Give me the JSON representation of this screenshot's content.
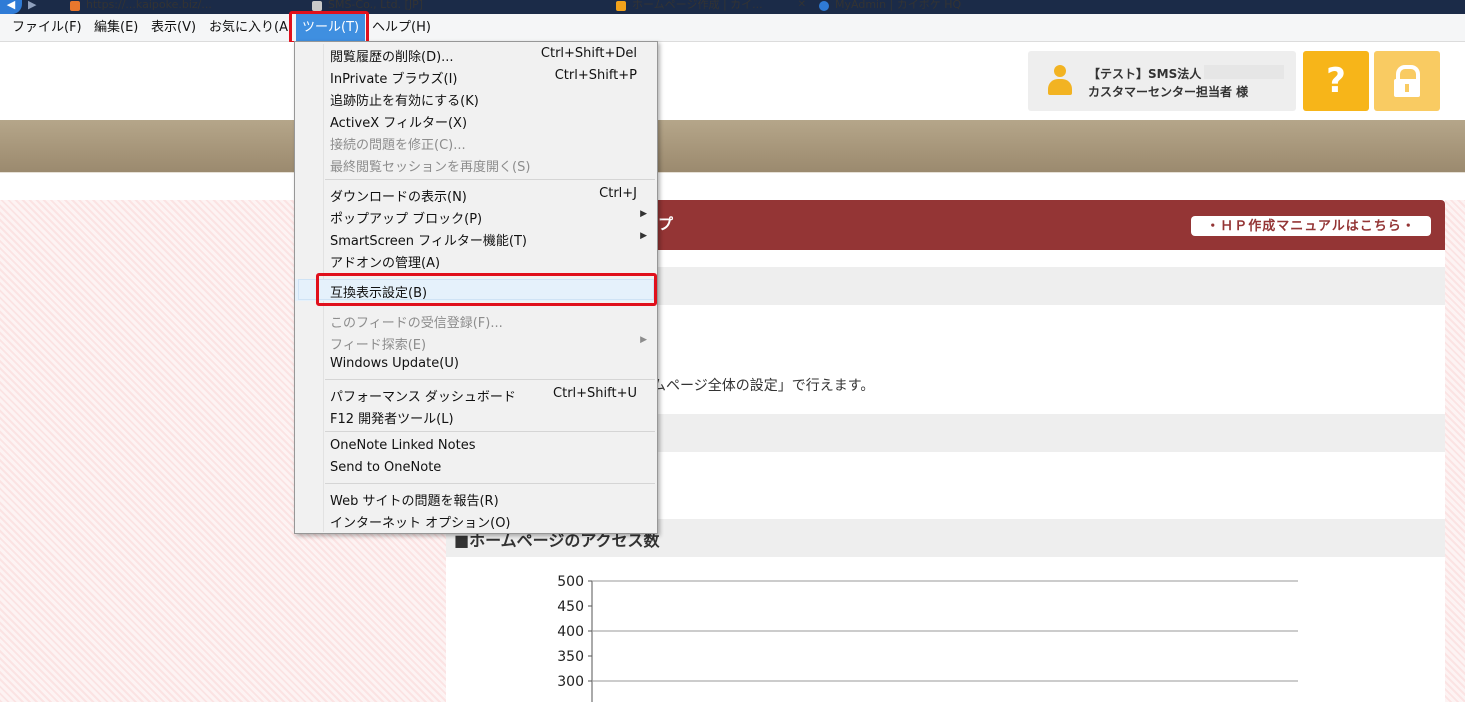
{
  "browser": {
    "tabs": [
      {
        "label": "https://...kaipoke.biz/...",
        "active": false,
        "color": "#4c9a2a"
      },
      {
        "label": "SMS-Co., Ltd. [JP]",
        "active": false,
        "color": "#e9e9e9"
      },
      {
        "label": "ホームページ作成 | カイ...",
        "active": true,
        "color": "#ffffff"
      },
      {
        "label": "MyAdmin | カイポケ HQ",
        "active": false,
        "color": "#e9e9e9"
      }
    ],
    "menu": [
      {
        "label": "ファイル(F)"
      },
      {
        "label": "編集(E)"
      },
      {
        "label": "表示(V)"
      },
      {
        "label": "お気に入り(A)"
      },
      {
        "label": "ツール(T)"
      },
      {
        "label": "ヘルプ(H)"
      }
    ]
  },
  "tools_menu": {
    "groups": [
      [
        {
          "label": "閲覧履歴の削除(D)...",
          "shortcut": "Ctrl+Shift+Del",
          "disabled": false
        },
        {
          "label": "InPrivate ブラウズ(I)",
          "shortcut": "Ctrl+Shift+P",
          "disabled": false
        },
        {
          "label": "追跡防止を有効にする(K)",
          "shortcut": "",
          "disabled": false
        },
        {
          "label": "ActiveX フィルター(X)",
          "shortcut": "",
          "disabled": false
        },
        {
          "label": "接続の問題を修正(C)...",
          "shortcut": "",
          "disabled": true
        },
        {
          "label": "最終閲覧セッションを再度開く(S)",
          "shortcut": "",
          "disabled": true
        }
      ],
      [
        {
          "label": "ダウンロードの表示(N)",
          "shortcut": "Ctrl+J",
          "disabled": false
        },
        {
          "label": "ポップアップ ブロック(P)",
          "shortcut": "",
          "submenu": true,
          "disabled": false
        },
        {
          "label": "SmartScreen フィルター機能(T)",
          "shortcut": "",
          "submenu": true,
          "disabled": false
        },
        {
          "label": "アドオンの管理(A)",
          "shortcut": "",
          "disabled": false
        }
      ],
      [
        {
          "label": "互換表示設定(B)",
          "shortcut": "",
          "disabled": false,
          "highlighted": true
        }
      ],
      [
        {
          "label": "このフィードの受信登録(F)...",
          "shortcut": "",
          "disabled": true
        },
        {
          "label": "フィード探索(E)",
          "shortcut": "",
          "submenu": true,
          "disabled": true
        },
        {
          "label": "Windows Update(U)",
          "shortcut": "",
          "disabled": false
        }
      ],
      [
        {
          "label": "パフォーマンス ダッシュボード",
          "shortcut": "Ctrl+Shift+U",
          "disabled": false
        },
        {
          "label": "F12 開発者ツール(L)",
          "shortcut": "",
          "disabled": false
        }
      ],
      [
        {
          "label": "OneNote Linked Notes",
          "shortcut": "",
          "disabled": false
        },
        {
          "label": "Send to OneNote",
          "shortcut": "",
          "disabled": false
        }
      ],
      [
        {
          "label": "Web サイトの問題を報告(R)",
          "shortcut": "",
          "disabled": false
        },
        {
          "label": "インターネット オプション(O)",
          "shortcut": "",
          "disabled": false
        }
      ]
    ]
  },
  "header": {
    "user_line1": "【テスト】SMS法人",
    "user_line2": "カスタマーセンター担当者 様",
    "help_label": "?",
    "colors": {
      "help": "#f7b519",
      "lock": "#f9cb62",
      "panel": "#943535"
    }
  },
  "main": {
    "panel_title_tail": "プ",
    "manual_button": "・ＨＰ作成マニュアルはこちら・",
    "content_text": "ムページ全体の設定」で行えます。",
    "access_heading": "■ホームページのアクセス数"
  },
  "chart_data": {
    "type": "line",
    "y_ticks": [
      500,
      450,
      400,
      350,
      300
    ],
    "ylim": [
      300,
      500
    ],
    "grid": true,
    "series": []
  }
}
